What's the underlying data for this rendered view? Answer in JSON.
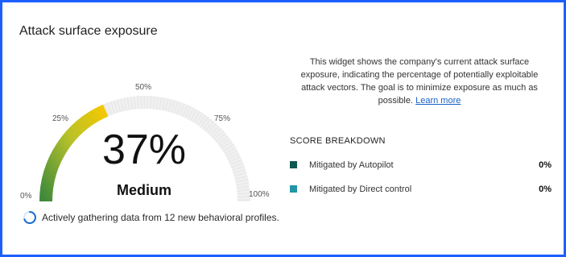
{
  "widget": {
    "title": "Attack surface exposure",
    "description": "This widget shows the company's current attack surface exposure, indicating the percentage of potentially exploitable attack vectors. The goal is to minimize exposure as much as possible.",
    "learn_more": "Learn more"
  },
  "gauge": {
    "value_text": "37%",
    "value_fraction": 0.37,
    "level": "Medium",
    "ticks": [
      "0%",
      "25%",
      "50%",
      "75%",
      "100%"
    ],
    "colors": {
      "start": "#3f8a3a",
      "middle": "#b8c22a",
      "end": "#f5c800",
      "track": "#f0f0f0"
    }
  },
  "status": {
    "text": "Actively gathering data from 12 new behavioral profiles.",
    "icon": "spinner-icon",
    "color": "#1a6fd1"
  },
  "breakdown": {
    "title": "SCORE BREAKDOWN",
    "items": [
      {
        "label": "Mitigated by Autopilot",
        "value": "0%",
        "color": "#0f5a4f"
      },
      {
        "label": "Mitigated by Direct control",
        "value": "0%",
        "color": "#2196a6"
      }
    ]
  }
}
